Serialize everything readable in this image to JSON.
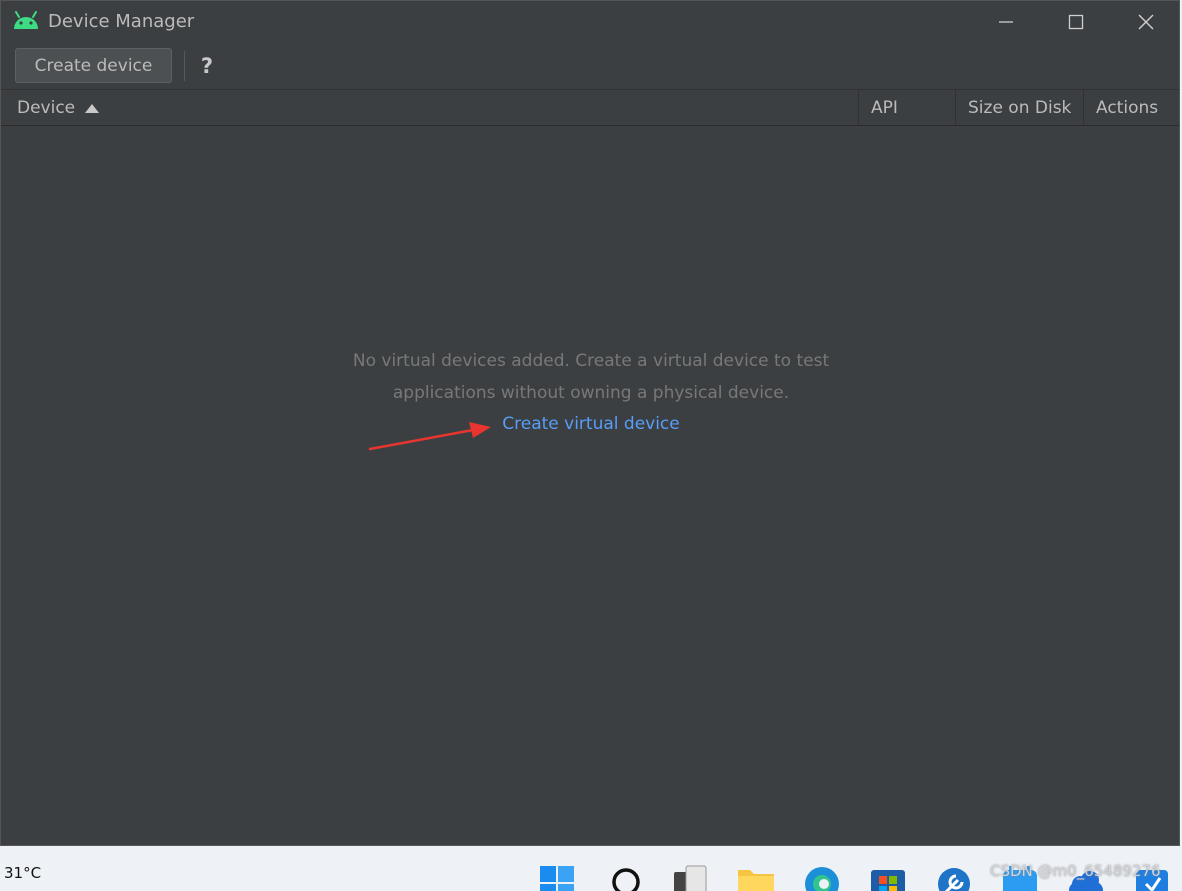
{
  "window": {
    "title": "Device Manager"
  },
  "toolbar": {
    "create_label": "Create device",
    "help_label": "?"
  },
  "table": {
    "columns": [
      "Device",
      "API",
      "Size on Disk",
      "Actions"
    ],
    "sort_column": "Device",
    "sort_direction": "ascending"
  },
  "empty_state": {
    "line1": "No virtual devices added. Create a virtual device to test",
    "line2": "applications without owning a physical device.",
    "link_label": "Create virtual device"
  },
  "taskbar": {
    "weather": "31°C",
    "icons": [
      "windows-start-icon",
      "search-icon",
      "task-view-icon",
      "file-explorer-icon",
      "edge-browser-icon",
      "store-icon",
      "tool-icon",
      "app-icon",
      "cloud-icon",
      "app-icon"
    ],
    "watermark": "CSDN @m0_65489276"
  },
  "colors": {
    "background": "#3c3f41",
    "text": "#bbbbbb",
    "muted_text": "#787878",
    "link": "#589df6",
    "annotation_arrow": "#e8352f",
    "android_green": "#3ddc84"
  }
}
